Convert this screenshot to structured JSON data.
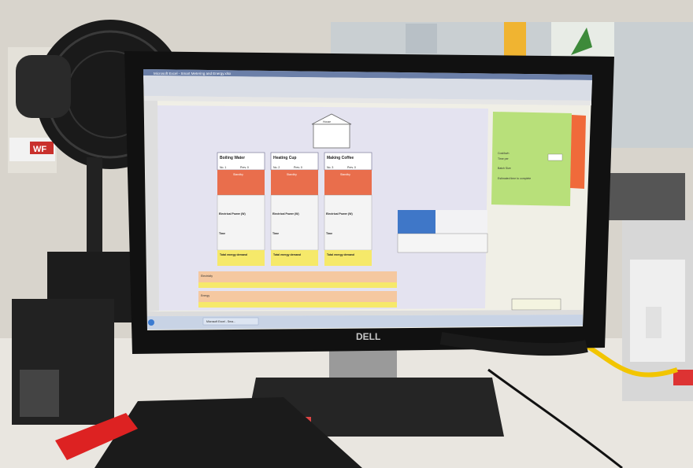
{
  "photo": {
    "monitor_brand": "DELL",
    "sign_left": "WF"
  },
  "app": {
    "window_title": "Microsoft Excel - Smart Metering and Energy.xlsx",
    "taskbar_item": "Microsoft Excel - Sma..."
  },
  "sheet": {
    "house_label": "House",
    "cards": [
      {
        "title": "Boiling Water",
        "rows": [
          "No. 1",
          "Prev. 0",
          "Standby",
          "Electrical Power (W)",
          "Time",
          "Total energy demand"
        ]
      },
      {
        "title": "Heating Cup",
        "rows": [
          "No. 2",
          "Prev. 0",
          "Standby",
          "Electrical Power (W)",
          "Time",
          "Total energy demand"
        ]
      },
      {
        "title": "Making Coffee",
        "rows": [
          "No. 3",
          "Prev. 0",
          "Standby",
          "Electrical Power (W)",
          "Time",
          "Total energy demand"
        ]
      }
    ],
    "summary_rows": [
      "Electricity",
      "Energy"
    ],
    "side_labels": [
      "Cost/kwh",
      "Time per",
      "Batch Size",
      "Estimated time to complete"
    ]
  }
}
